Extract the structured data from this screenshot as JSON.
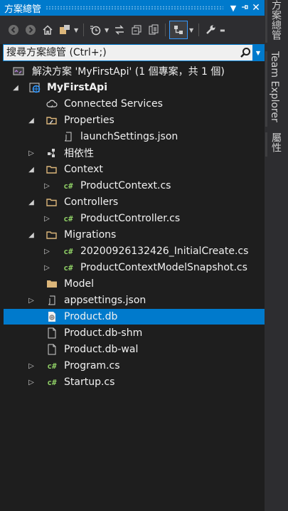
{
  "panel": {
    "title": "方案總管",
    "pin_icon": "dropdown-pin",
    "autohide_icon": "pin-icon",
    "close_icon": "close-icon"
  },
  "search": {
    "placeholder": "搜尋方案總管 (Ctrl+;)"
  },
  "sidetabs": [
    "方案總管",
    "Team Explorer",
    "屬性"
  ],
  "tree": {
    "solution": "解決方案 'MyFirstApi' (1 個專案，共 1 個)",
    "project": "MyFirstApi",
    "items": {
      "connected": "Connected Services",
      "properties": "Properties",
      "launch": "launchSettings.json",
      "deps": "相依性",
      "context": "Context",
      "productcontext": "ProductContext.cs",
      "controllers": "Controllers",
      "productcontroller": "ProductController.cs",
      "migrations": "Migrations",
      "initialcreate": "20200926132426_InitialCreate.cs",
      "snapshot": "ProductContextModelSnapshot.cs",
      "model": "Model",
      "appsettings": "appsettings.json",
      "productdb": "Product.db",
      "productdbshm": "Product.db-shm",
      "productdbwal": "Product.db-wal",
      "program": "Program.cs",
      "startup": "Startup.cs"
    },
    "selected": "Product.db"
  },
  "colors": {
    "accent": "#007acc",
    "background": "#1e1e1e",
    "toolbar": "#2d2d30",
    "csharp": "#8ece65",
    "folder": "#dcb67a"
  }
}
